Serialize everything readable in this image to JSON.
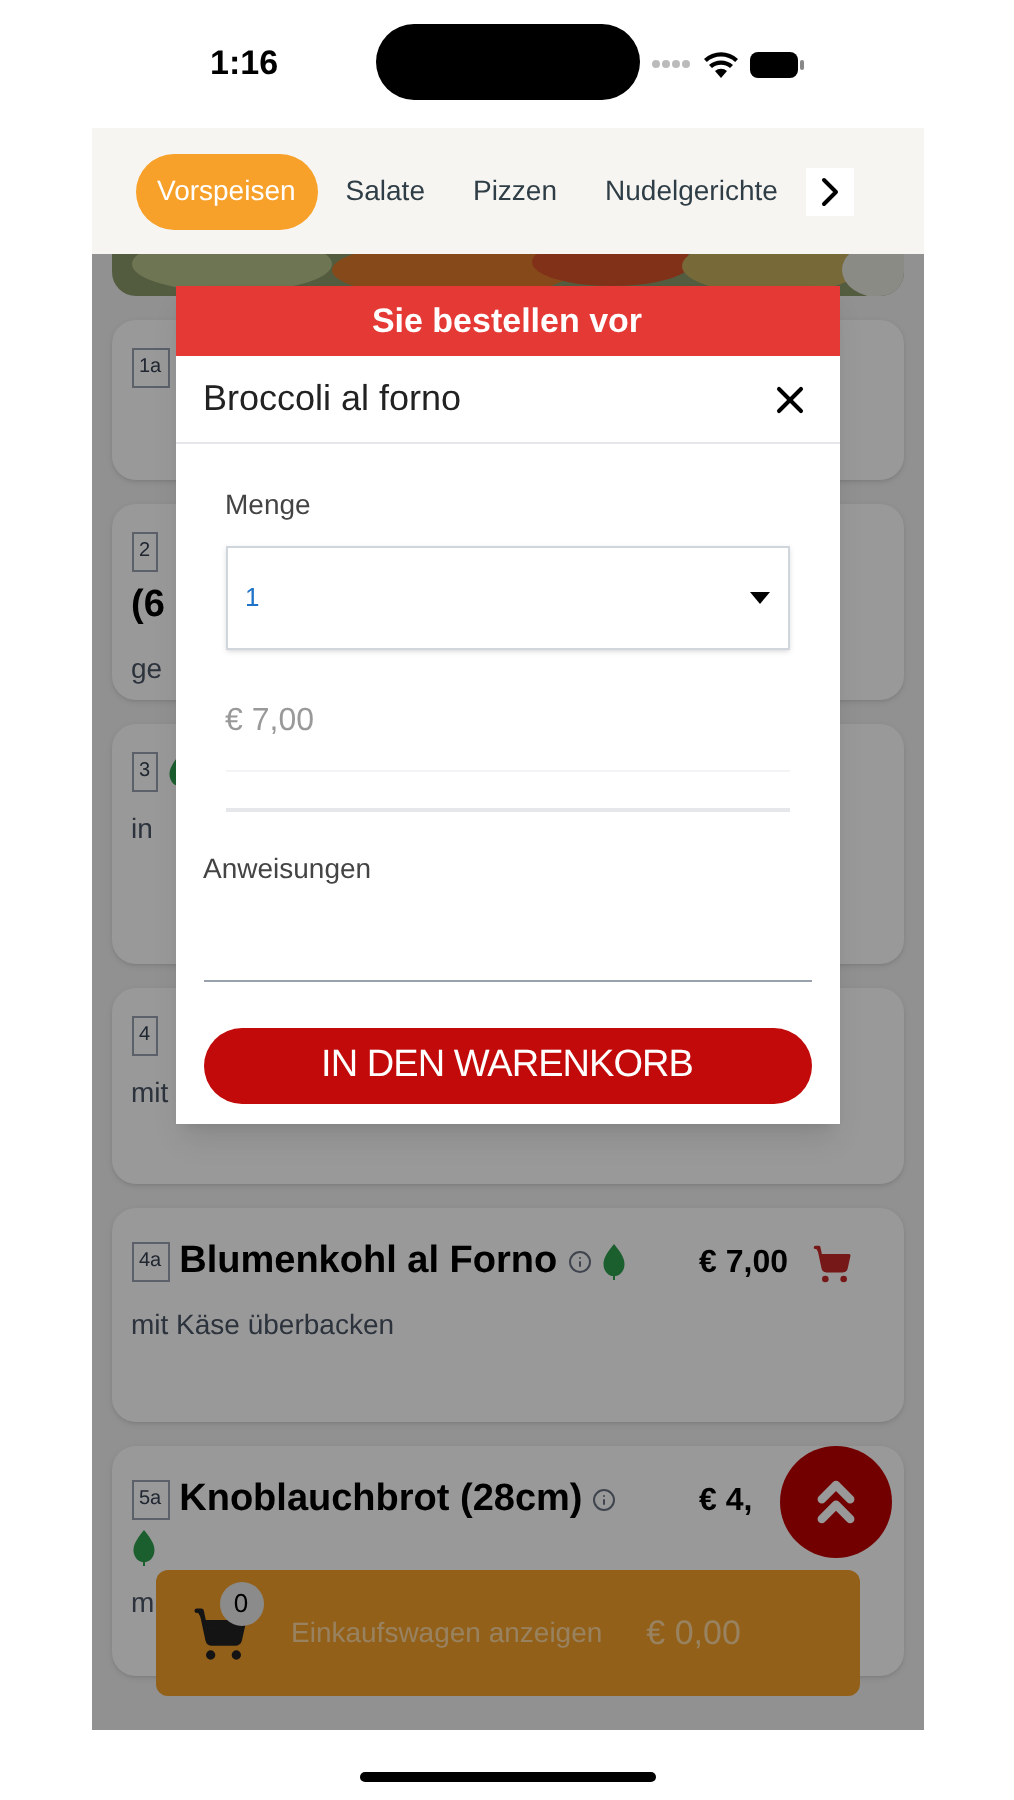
{
  "status_bar": {
    "time": "1:16"
  },
  "tabs": [
    {
      "label": "Vorspeisen",
      "selected": true
    },
    {
      "label": "Salate",
      "selected": false
    },
    {
      "label": "Pizzen",
      "selected": false
    },
    {
      "label": "Nudelgerichte",
      "selected": false
    }
  ],
  "menu_items": [
    {
      "code": "1a",
      "veg": false,
      "info": false
    },
    {
      "code": "2",
      "kind": "stacked",
      "title": "(6",
      "description": "ge",
      "veg": false,
      "info": false
    },
    {
      "code": "3",
      "description": "in",
      "veg": true,
      "info": false
    },
    {
      "code": "4",
      "description": "mit",
      "veg": false,
      "info": false
    },
    {
      "code": "4a",
      "title": "Blumenkohl al Forno",
      "price": "€ 7,00",
      "cart_icon": true,
      "description": "mit Käse überbacken",
      "veg": true,
      "info": true
    },
    {
      "code": "5a",
      "title": "Knoblauchbrot (28cm)",
      "price": "€ 4,",
      "cart_icon": false,
      "description": "m",
      "veg": true,
      "info": true
    }
  ],
  "dialog": {
    "header": "Sie bestellen vor",
    "item_name": "Broccoli al forno",
    "quantity_label": "Menge",
    "quantity": "1",
    "price": "€ 7,00",
    "instructions_label": "Anweisungen",
    "submit_label": "IN DEN WARENKORB"
  },
  "cart_bar": {
    "count": "0",
    "label": "Einkaufswagen anzeigen",
    "total": "€ 0,00"
  }
}
